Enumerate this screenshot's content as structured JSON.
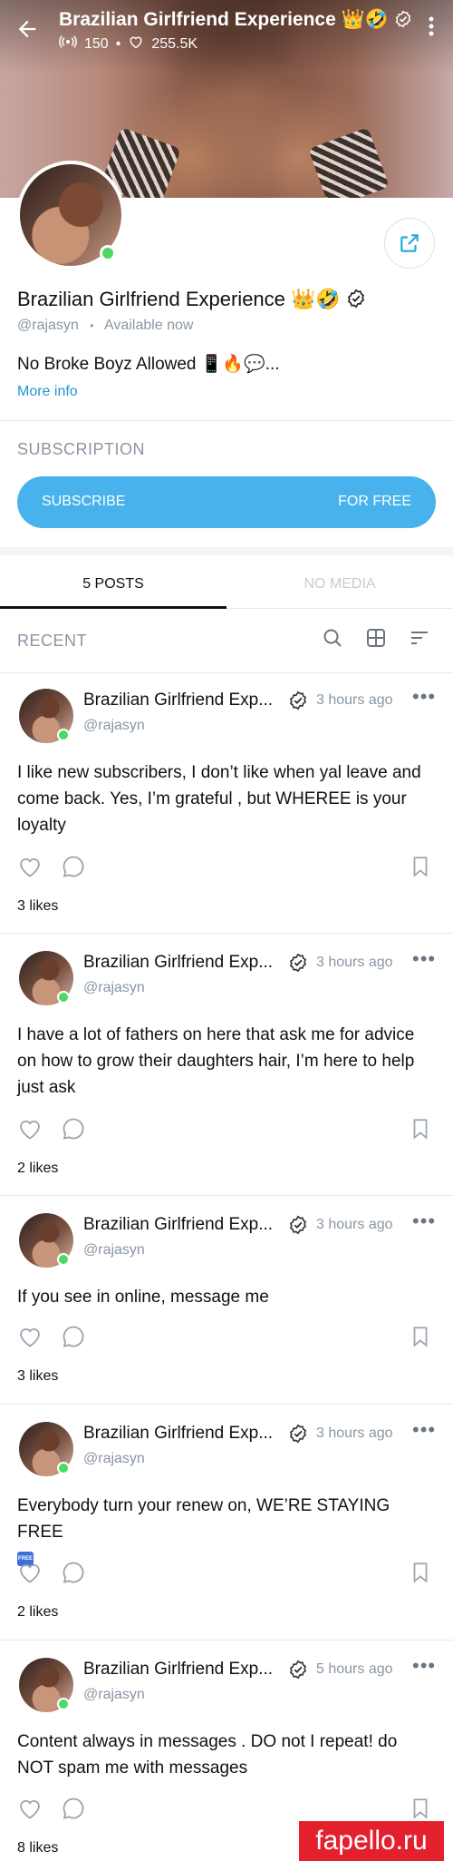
{
  "header": {
    "title": "Brazilian Girlfriend Experience 👑🤣",
    "live_count": "150",
    "likes_count": "255.5K",
    "dot": "•"
  },
  "profile": {
    "name": "Brazilian Girlfriend Experience 👑🤣",
    "handle": "@rajasyn",
    "separator": "•",
    "status": "Available now",
    "bio": "No Broke Boyz Allowed 📱🔥💬...",
    "more_info": "More info"
  },
  "subscription": {
    "heading": "SUBSCRIPTION",
    "button_left": "SUBSCRIBE",
    "button_right": "FOR FREE"
  },
  "tabs": [
    {
      "label": "5 POSTS",
      "active": true
    },
    {
      "label": "NO MEDIA",
      "active": false
    }
  ],
  "recent": {
    "label": "RECENT",
    "icons": [
      "search-icon",
      "grid-icon",
      "sort-icon"
    ]
  },
  "posts": [
    {
      "name": "Brazilian Girlfriend Exp...",
      "handle": "@rajasyn",
      "time": "3 hours ago",
      "text": "I like new subscribers, I don’t like when yal leave and come back. Yes, I’m grateful , but WHEREE is your loyalty",
      "likes": "3 likes"
    },
    {
      "name": "Brazilian Girlfriend Exp...",
      "handle": "@rajasyn",
      "time": "3 hours ago",
      "text": "I have a lot of fathers on here that ask me for advice on how to grow their daughters hair, I’m here to help just ask",
      "likes": "2 likes"
    },
    {
      "name": "Brazilian Girlfriend Exp...",
      "handle": "@rajasyn",
      "time": "3 hours ago",
      "text": "If you see in online, message me",
      "likes": "3 likes"
    },
    {
      "name": "Brazilian Girlfriend Exp...",
      "handle": "@rajasyn",
      "time": "3 hours ago",
      "text": "Everybody turn your renew on, WE’RE STAYING FREE",
      "badge": "FREE",
      "likes": "2 likes"
    },
    {
      "name": "Brazilian Girlfriend Exp...",
      "handle": "@rajasyn",
      "time": "5 hours ago",
      "text": "Content always in messages . DO not I repeat! do NOT spam me with messages",
      "likes": "8 likes"
    }
  ],
  "watermark": "fapello.ru",
  "colors": {
    "accent": "#47b2ec",
    "link": "#2496d6",
    "online": "#4cd964",
    "muted": "#8a96a3",
    "watermark_bg": "#e4202e"
  }
}
